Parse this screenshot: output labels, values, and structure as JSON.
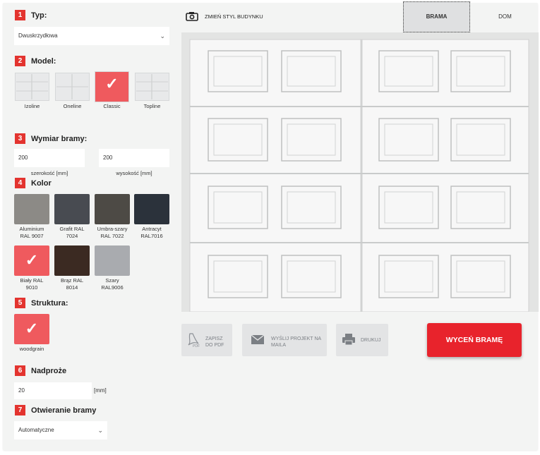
{
  "steps": {
    "s1": {
      "num": "1",
      "title": "Typ:"
    },
    "s2": {
      "num": "2",
      "title": "Model:"
    },
    "s3": {
      "num": "3",
      "title": "Wymiar bramy:"
    },
    "s4": {
      "num": "4",
      "title": "Kolor"
    },
    "s5": {
      "num": "5",
      "title": "Struktura:"
    },
    "s6": {
      "num": "6",
      "title": "Nadproże"
    },
    "s7": {
      "num": "7",
      "title": "Otwieranie bramy"
    }
  },
  "type_select": {
    "value": "Dwuskrzydłowa",
    "icon": "chevron-down-icon"
  },
  "models": [
    {
      "label": "Izoline",
      "selected": false
    },
    {
      "label": "Oneline",
      "selected": false
    },
    {
      "label": "Classic",
      "selected": true
    },
    {
      "label": "Topline",
      "selected": false
    }
  ],
  "dimensions": {
    "width_value": "200",
    "width_label": "szerokość [mm]",
    "height_value": "200",
    "height_label": "wysokość [mm]"
  },
  "colors": [
    {
      "label1": "Aluminium",
      "label2": "RAL 9007",
      "hex": "#8c8a86",
      "selected": false
    },
    {
      "label1": "Grafit RAL",
      "label2": "7024",
      "hex": "#484b51",
      "selected": false
    },
    {
      "label1": "Umbra-szary",
      "label2": "RAL 7022",
      "hex": "#4d4a45",
      "selected": false
    },
    {
      "label1": "Antracyt",
      "label2": "RAL7016",
      "hex": "#2b323b",
      "selected": false
    },
    {
      "label1": "Biały RAL",
      "label2": "9010",
      "hex": "#ef5a5e",
      "selected": true
    },
    {
      "label1": "Brąz RAL",
      "label2": "8014",
      "hex": "#3b2a22",
      "selected": false
    },
    {
      "label1": "Szary",
      "label2": "RAL9006",
      "hex": "#a9abaf",
      "selected": false
    }
  ],
  "structure": {
    "label": "woodgrain",
    "selected": true
  },
  "lintel": {
    "value": "20",
    "unit": "[mm]"
  },
  "opening_select": {
    "value": "Automatyczne",
    "icon": "chevron-down-icon"
  },
  "toolbar": {
    "change_style": "ZMIEŃ STYL BUDYNKU",
    "camera_icon": "camera-icon"
  },
  "view_tabs": [
    {
      "label": "BRAMA",
      "active": true
    },
    {
      "label": "DOM",
      "active": false
    }
  ],
  "actions": {
    "save_pdf_l1": "ZAPISZ",
    "save_pdf_l2": "DO PDF",
    "send_mail_l1": "WYŚLIJ PROJEKT NA",
    "send_mail_l2": "MAILA",
    "print": "DRUKUJ",
    "quote": "WYCEŃ BRAMĘ"
  },
  "colors_ui": {
    "accent": "#e3342f",
    "door": "#f7f7f7"
  }
}
